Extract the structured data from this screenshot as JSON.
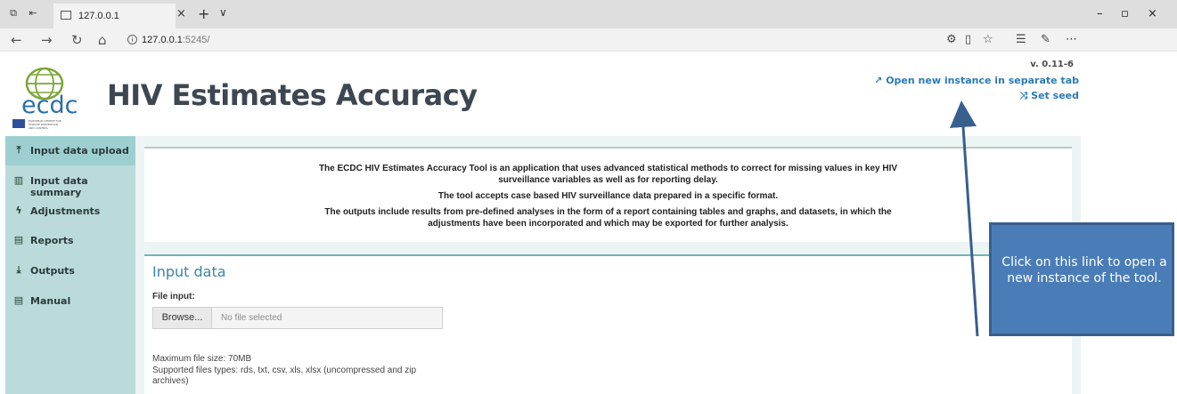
{
  "browser": {
    "tab_title": "127.0.0.1",
    "url_host": "127.0.0.1",
    "url_port": ":5245/",
    "info_glyph": "i"
  },
  "header": {
    "title": "HIV Estimates Accuracy",
    "version": "v. 0.11-6",
    "open_new_instance": "Open new instance in separate tab",
    "set_seed": "Set seed",
    "logo_text": "ecdc",
    "logo_subtext": "EUROPEAN CENTRE FOR DISEASE PREVENTION AND CONTROL"
  },
  "sidebar": {
    "items": [
      {
        "label": "Input data upload",
        "icon": "upload-icon",
        "active": true
      },
      {
        "label": "Input data summary",
        "icon": "bar-chart-icon",
        "active": false
      },
      {
        "label": "Adjustments",
        "icon": "bolt-icon",
        "active": false
      },
      {
        "label": "Reports",
        "icon": "report-icon",
        "active": false
      },
      {
        "label": "Outputs",
        "icon": "download-icon",
        "active": false
      },
      {
        "label": "Manual",
        "icon": "book-icon",
        "active": false
      }
    ]
  },
  "intro": {
    "line1": "The ECDC HIV Estimates Accuracy Tool is an application that uses advanced statistical methods to correct for missing values in key HIV",
    "line2": "surveillance variables as well as for reporting delay.",
    "line3": "The tool accepts case based HIV surveillance data prepared in a specific format.",
    "line4": "The outputs include results from pre-defined analyses in the form of a report containing tables and graphs, and datasets, in which the",
    "line5": "adjustments have been incorporated and which may be exported for further analysis."
  },
  "input_panel": {
    "title": "Input data",
    "file_label": "File input:",
    "browse_label": "Browse...",
    "no_file": "No file selected",
    "max_size": "Maximum file size: 70MB",
    "supported_line1": "Supported files types: rds, txt, csv, xls, xlsx (uncompressed and zip",
    "supported_line2": "archives)"
  },
  "callout": {
    "text": "Click on this link to open a new instance of the tool."
  },
  "colors": {
    "sidebar_bg": "#bbdada",
    "sidebar_active": "#9ecfd0",
    "link": "#2a7ab5",
    "callout": "#4a7db8",
    "title": "#3d4752"
  }
}
